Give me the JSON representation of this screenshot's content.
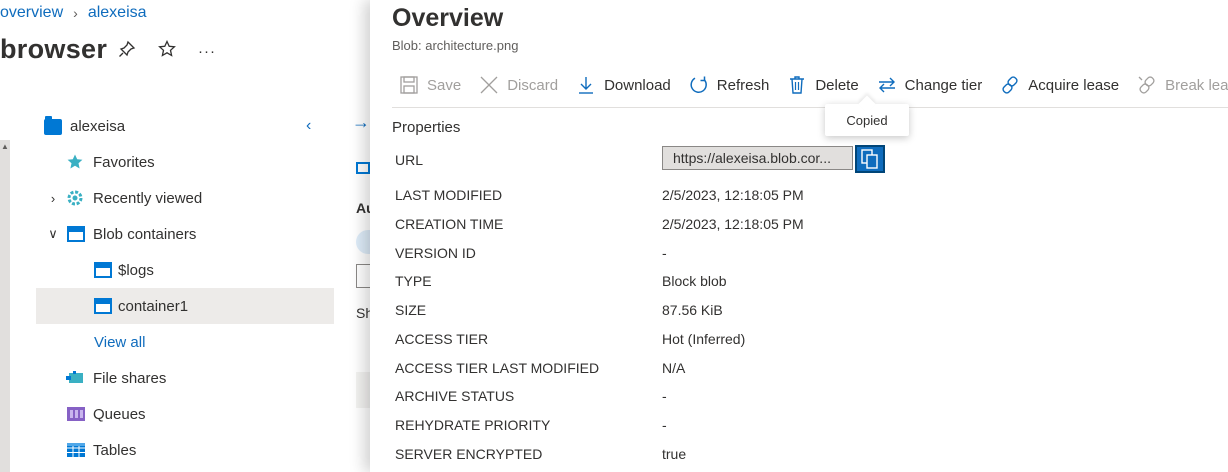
{
  "breadcrumb": {
    "items": [
      "overview",
      "alexeisa"
    ]
  },
  "left": {
    "title": "browser",
    "actions": {
      "more": "···"
    },
    "tree": [
      {
        "label": "alexeisa",
        "icon": "storage-account-icon"
      },
      {
        "label": "Favorites",
        "icon": "star-icon"
      },
      {
        "label": "Recently viewed",
        "icon": "gear-icon"
      },
      {
        "label": "Blob containers",
        "icon": "container-icon"
      },
      {
        "label": "$logs",
        "icon": "container-icon"
      },
      {
        "label": "container1",
        "icon": "container-icon",
        "selected": true
      },
      {
        "label": "View all"
      },
      {
        "label": "File shares",
        "icon": "file-share-icon"
      },
      {
        "label": "Queues",
        "icon": "queue-icon"
      },
      {
        "label": "Tables",
        "icon": "table-icon"
      }
    ],
    "peek": {
      "a": "Au",
      "b": "Sh"
    }
  },
  "panel": {
    "title": "Overview",
    "subtitle": "Blob: architecture.png",
    "toolbar": {
      "save": "Save",
      "discard": "Discard",
      "download": "Download",
      "refresh": "Refresh",
      "delete": "Delete",
      "change_tier": "Change tier",
      "acquire_lease": "Acquire lease",
      "break_lease": "Break lease"
    },
    "tooltip": "Copied",
    "section": "Properties",
    "url_label": "URL",
    "url_value": "https://alexeisa.blob.cor...",
    "properties": [
      {
        "key": "LAST MODIFIED",
        "value": "2/5/2023, 12:18:05 PM"
      },
      {
        "key": "CREATION TIME",
        "value": "2/5/2023, 12:18:05 PM"
      },
      {
        "key": "VERSION ID",
        "value": "-"
      },
      {
        "key": "TYPE",
        "value": "Block blob"
      },
      {
        "key": "SIZE",
        "value": "87.56 KiB"
      },
      {
        "key": "ACCESS TIER",
        "value": "Hot (Inferred)"
      },
      {
        "key": "ACCESS TIER LAST MODIFIED",
        "value": "N/A"
      },
      {
        "key": "ARCHIVE STATUS",
        "value": "-"
      },
      {
        "key": "REHYDRATE PRIORITY",
        "value": "-"
      },
      {
        "key": "SERVER ENCRYPTED",
        "value": "true"
      }
    ]
  },
  "colors": {
    "accent": "#0f6cbd",
    "disabled": "#a19f9d",
    "selected_row": "#edebe9"
  }
}
